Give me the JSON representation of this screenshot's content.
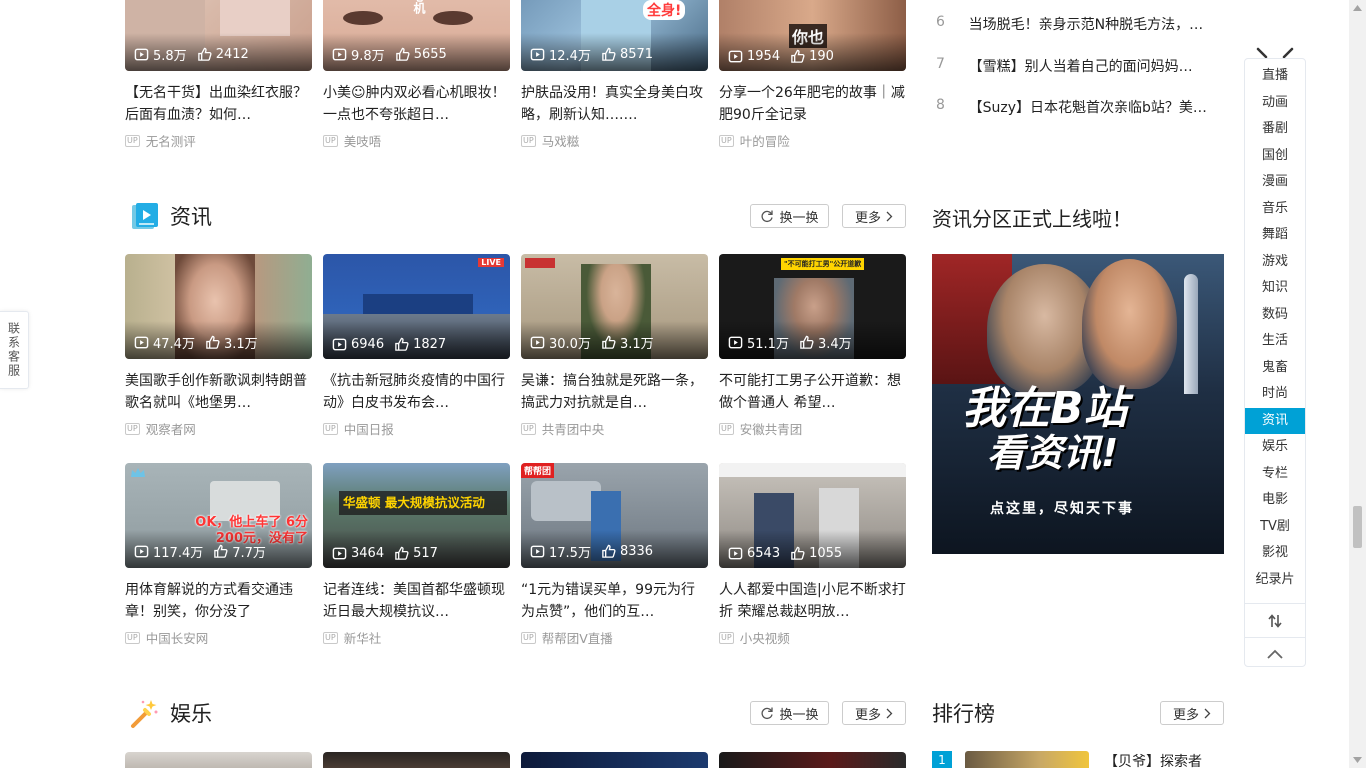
{
  "top_row_cards": [
    {
      "views": "5.8万",
      "likes": "2412",
      "title": "【无名干货】出血染红衣服？后面有血渍？如何…",
      "up": "无名测评"
    },
    {
      "views": "9.8万",
      "likes": "5655",
      "title": "小美☺肿内双必看心机眼妆！一点也不夸张超日…",
      "up": "美吱唔"
    },
    {
      "views": "12.4万",
      "likes": "8571",
      "title": "护肤品没用！真实全身美白攻略，刷新认知….…",
      "up": "马戏糍"
    },
    {
      "views": "1954",
      "likes": "190",
      "title": "分享一个26年肥宅的故事｜减肥90斤全记录",
      "up": "叶的冒险"
    }
  ],
  "top_thumb_texts": {
    "t2": "双心机",
    "t3": "全身!",
    "t4": "你也"
  },
  "top_rank": [
    {
      "num": "6",
      "text": "当场脱毛！亲身示范N种脱毛方法，…"
    },
    {
      "num": "7",
      "text": "【雪糕】别人当着自己的面问妈妈…"
    },
    {
      "num": "8",
      "text": "【Suzy】日本花魁首次亲临b站？美…"
    }
  ],
  "news": {
    "title": "资讯",
    "refresh_label": "换一换",
    "more_label": "更多",
    "promo_title": "资讯分区正式上线啦！",
    "promo_line1": "我在B站",
    "promo_line2": "看资讯!",
    "promo_sub": "点这里，尽知天下事",
    "cards": [
      {
        "views": "47.4万",
        "likes": "3.1万",
        "title": "美国歌手创作新歌讽刺特朗普 歌名就叫《地堡男…",
        "up": "观察者网"
      },
      {
        "views": "6946",
        "likes": "1827",
        "title": "《抗击新冠肺炎疫情的中国行动》白皮书发布会…",
        "up": "中国日报",
        "thumb_text": "LIVE"
      },
      {
        "views": "30.0万",
        "likes": "3.1万",
        "title": "吴谦：搞台独就是死路一条，搞武力对抗就是自…",
        "up": "共青团中央"
      },
      {
        "views": "51.1万",
        "likes": "3.4万",
        "title": "不可能打工男子公开道歉：想做个普通人 希望…",
        "up": "安徽共青团",
        "thumb_text": "\"不可能打工男\"公开道歉"
      },
      {
        "views": "117.4万",
        "likes": "7.7万",
        "title": "用体育解说的方式看交通违章！别笑，你分没了",
        "up": "中国长安网",
        "thumb_text": "OK，他上车了 6分200元，没有了"
      },
      {
        "views": "3464",
        "likes": "517",
        "title": "记者连线：美国首都华盛顿现近日最大规模抗议…",
        "up": "新华社",
        "thumb_text": "华盛顿 最大规模抗议活动"
      },
      {
        "views": "17.5万",
        "likes": "8336",
        "title": "“1元为错误买单，99元为行为点赞”，他们的互…",
        "up": "帮帮团V直播",
        "thumb_text": "帮帮团"
      },
      {
        "views": "6543",
        "likes": "1055",
        "title": "人人都爱中国造|小尼不断求打折 荣耀总裁赵明放…",
        "up": "小央视频"
      }
    ]
  },
  "ent": {
    "title": "娱乐",
    "refresh_label": "换一换",
    "more_label": "更多",
    "rank_title": "排行榜",
    "rank_more": "更多",
    "rank_first_num": "1",
    "rank_first_text": "【贝爷】探索者"
  },
  "sidenav": {
    "items": [
      "直播",
      "动画",
      "番剧",
      "国创",
      "漫画",
      "音乐",
      "舞蹈",
      "游戏",
      "知识",
      "数码",
      "生活",
      "鬼畜",
      "时尚",
      "资讯",
      "娱乐",
      "专栏",
      "电影",
      "TV剧",
      "影视",
      "纪录片"
    ],
    "active": "资讯"
  },
  "contact_label": "联系客服",
  "colors": {
    "accent": "#00a1d6",
    "text": "#212121",
    "muted": "#999999"
  }
}
